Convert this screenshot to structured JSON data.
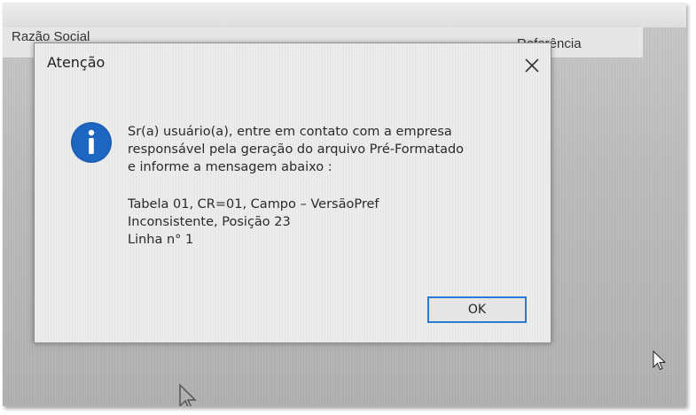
{
  "background": {
    "column_1": "Razão Social",
    "column_2": "Referência"
  },
  "dialog": {
    "title": "Atenção",
    "close_icon": "close-icon",
    "icon": "info-icon",
    "message_lines": [
      "Sr(a) usuário(a), entre em contato com a empresa",
      "responsável pela geração do arquivo Pré-Formatado",
      "e informe a mensagem abaixo :"
    ],
    "detail_lines": [
      "Tabela 01, CR=01, Campo – VersãoPref",
      "Inconsistente, Posição 23",
      "Linha n° 1"
    ],
    "ok_label": "OK"
  },
  "colors": {
    "info_icon": "#1a5fb4",
    "ok_border": "#2a7ad5"
  }
}
